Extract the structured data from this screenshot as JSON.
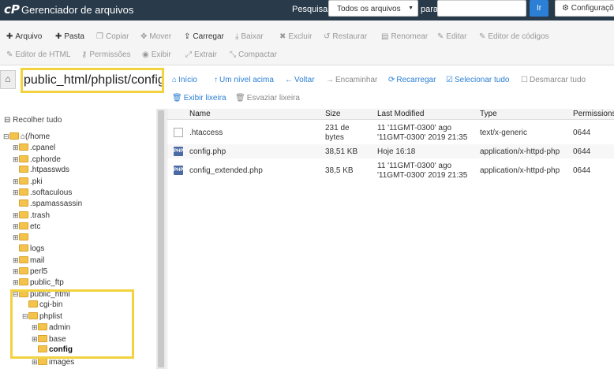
{
  "header": {
    "logo": "cP",
    "title": "Gerenciador de arquivos",
    "search_label": "Pesquisar",
    "search_scope": "Todos os arquivos",
    "for_label": "para",
    "search_value": "",
    "go_label": "Ir",
    "settings_label": "Configurações"
  },
  "toolbar": {
    "file": "Arquivo",
    "folder": "Pasta",
    "copy": "Copiar",
    "move": "Mover",
    "upload": "Carregar",
    "download": "Baixar",
    "delete": "Excluir",
    "restore": "Restaurar",
    "rename": "Renomear",
    "edit": "Editar",
    "code_editor": "Editor de códigos",
    "html_editor": "Editor de HTML",
    "permissions": "Permissões",
    "view": "Exibir",
    "extract": "Extrair",
    "compress": "Compactar"
  },
  "path": {
    "current": "public_html/phplist/config"
  },
  "nav": {
    "home": "Início",
    "up": "Um nível acima",
    "back": "Voltar",
    "forward": "Encaminhar",
    "reload": "Recarregar",
    "select_all": "Selecionar tudo",
    "unselect_all": "Desmarcar tudo",
    "view_trash": "Exibir lixeira",
    "empty_trash": "Esvaziar lixeira"
  },
  "tree": {
    "collapse_all": "Recolher tudo",
    "root": "(/home",
    "items": [
      {
        "exp": "⊞",
        "label": ".cpanel"
      },
      {
        "exp": "⊞",
        "label": ".cphorde"
      },
      {
        "exp": "",
        "label": ".htpasswds"
      },
      {
        "exp": "⊞",
        "label": ".pki"
      },
      {
        "exp": "⊞",
        "label": ".softaculous"
      },
      {
        "exp": "",
        "label": ".spamassassin"
      },
      {
        "exp": "⊞",
        "label": ".trash"
      },
      {
        "exp": "⊞",
        "label": "etc"
      },
      {
        "exp": "⊞",
        "label": ""
      },
      {
        "exp": "",
        "label": "logs"
      },
      {
        "exp": "⊞",
        "label": "mail"
      },
      {
        "exp": "⊞",
        "label": "perl5"
      },
      {
        "exp": "⊞",
        "label": "public_ftp"
      },
      {
        "exp": "⊟",
        "label": "public_html"
      },
      {
        "exp": "",
        "label": "cgi-bin"
      },
      {
        "exp": "⊟",
        "label": "phplist"
      },
      {
        "exp": "⊞",
        "label": "admin"
      },
      {
        "exp": "⊞",
        "label": "base"
      },
      {
        "exp": "",
        "label": "config"
      },
      {
        "exp": "⊞",
        "label": "images"
      }
    ]
  },
  "table": {
    "headers": [
      "Name",
      "Size",
      "Last Modified",
      "Type",
      "Permissions"
    ],
    "rows": [
      {
        "icon": "text-file-icon",
        "name": ".htaccess",
        "size": "231 de bytes",
        "size1": "231 de",
        "size2": "bytes",
        "mod1": "11 '11GMT-0300' ago",
        "mod2": "'11GMT-0300' 2019 21:35",
        "type": "text/x-generic",
        "perm": "0644"
      },
      {
        "icon": "php-file-icon",
        "name": "config.php",
        "size": "38,51 KB",
        "mod1": "Hoje 16:18",
        "mod2": "",
        "type": "application/x-httpd-php",
        "perm": "0644"
      },
      {
        "icon": "php-file-icon",
        "name": "config_extended.php",
        "size": "38,5 KB",
        "mod1": "11 '11GMT-0300' ago",
        "mod2": "'11GMT-0300' 2019 21:35",
        "type": "application/x-httpd-php",
        "perm": "0644"
      }
    ]
  },
  "colors": {
    "header_bg": "#293a4a",
    "accent": "#2b7fd4",
    "highlight": "#f3d23f",
    "folder": "#f4c34c"
  }
}
